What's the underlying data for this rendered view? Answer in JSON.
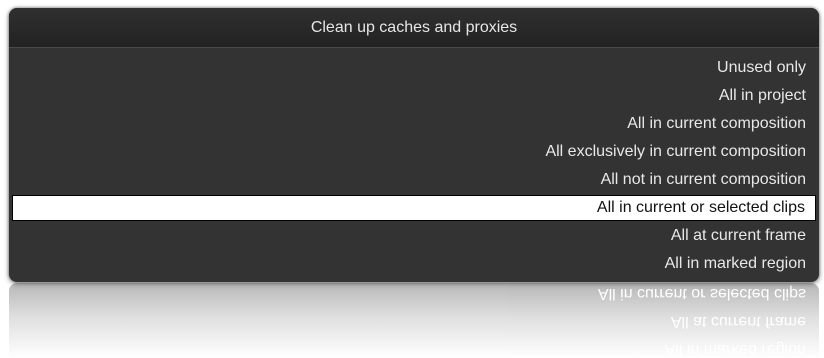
{
  "menu": {
    "title": "Clean up caches and proxies",
    "items": [
      {
        "label": "Unused only"
      },
      {
        "label": "All in project"
      },
      {
        "label": "All in current composition"
      },
      {
        "label": "All exclusively in current composition"
      },
      {
        "label": "All not in current composition"
      },
      {
        "label": "All in current or selected clips"
      },
      {
        "label": "All at current frame"
      },
      {
        "label": "All in marked region"
      }
    ],
    "selected_index": 5
  },
  "colors": {
    "menu_background": "#333333",
    "header_background": "#262626",
    "text": "#e8e8e8",
    "selected_background": "#ffffff",
    "selected_text": "#111111"
  }
}
